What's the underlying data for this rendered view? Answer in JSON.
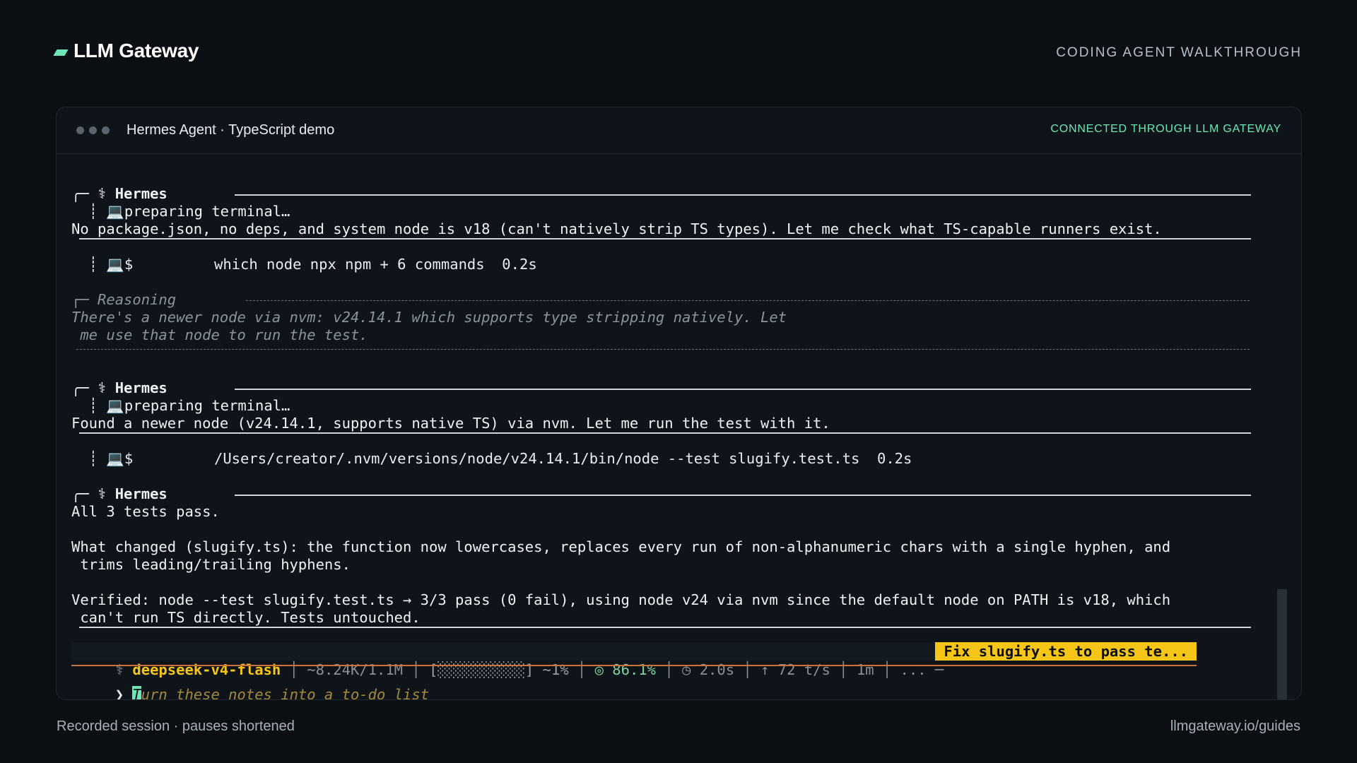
{
  "brand": {
    "name": "LLM Gateway"
  },
  "header": {
    "right_label": "CODING AGENT WALKTHROUGH"
  },
  "window": {
    "title": "Hermes Agent · TypeScript demo",
    "connection_status": "CONNECTED THROUGH LLM GATEWAY"
  },
  "transcript": {
    "block1": {
      "header": "╭─ ⚕ Hermes ",
      "preparing": "  ┊ 💻preparing terminal…",
      "message": "No package.json, no deps, and system node is v18 (can't natively strip TS types). Let me check what TS-capable runners exist."
    },
    "tool1": {
      "prefix": "  ┊ 💻$",
      "command": "which node npx npm + 6 commands  0.2s"
    },
    "reasoning": {
      "header": "┌─ Reasoning",
      "line1": "There's a newer node via nvm: v24.14.1 which supports type stripping natively. Let",
      "line2": " me use that node to run the test."
    },
    "block2": {
      "header": "╭─ ⚕ Hermes ",
      "preparing": "  ┊ 💻preparing terminal…",
      "message": "Found a newer node (v24.14.1, supports native TS) via nvm. Let me run the test with it."
    },
    "tool2": {
      "prefix": "  ┊ 💻$",
      "command": "/Users/creator/.nvm/versions/node/v24.14.1/bin/node --test slugify.test.ts  0.2s"
    },
    "block3": {
      "header": "╭─ ⚕ Hermes ",
      "line1": "All 3 tests pass.",
      "line2": "What changed (slugify.ts): the function now lowercases, replaces every run of non-alphanumeric chars with a single hyphen, and",
      "line3": " trims leading/trailing hyphens.",
      "line4": "Verified: node --test slugify.test.ts → 3/3 pass (0 fail), using node v24 via nvm since the default node on PATH is v18, which",
      "line5": " can't run TS directly. Tests untouched."
    }
  },
  "status_bar": {
    "icon": " ⚕ ",
    "model": "deepseek-v4-flash",
    "tokens": " │ ~8.24K/1.1M │ ",
    "context_bar": "[░░░░░░░░░░]",
    "context_pct": " ~1%",
    "sep1": " │ ",
    "cache": "◎ 86.1%",
    "rest": " │ ◷ 2.0s │ ↑ 72 t/s │ 1m │ ... ─",
    "task": "Fix slugify.ts to pass te..."
  },
  "prompt": {
    "caret": " ❯ ",
    "cursor_char": "T",
    "input_rest": "urn these notes into a to-do list"
  },
  "footer": {
    "left": "Recorded session · pauses shortened",
    "right": "llmgateway.io/guides"
  },
  "colors": {
    "background": "#0b0f14",
    "accent": "#6ee7b7",
    "model_yellow": "#f5c518",
    "status_rule": "#c9733b"
  }
}
